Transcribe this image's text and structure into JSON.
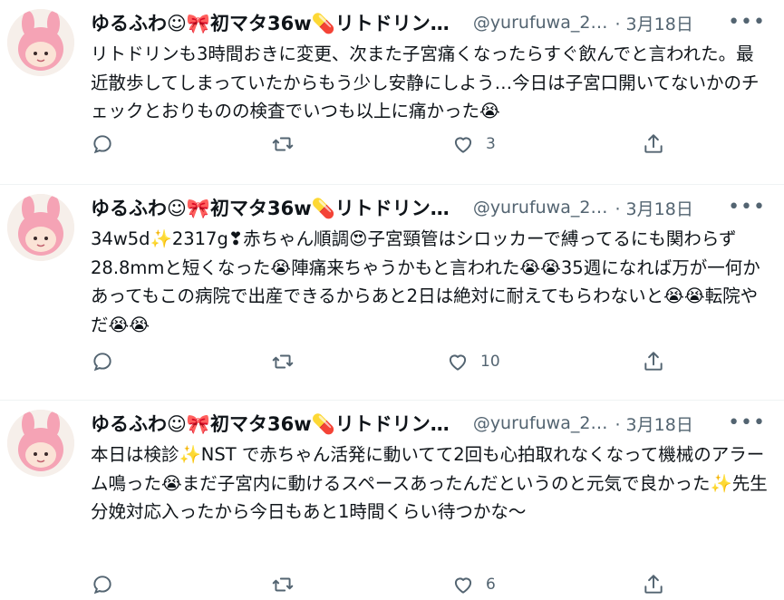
{
  "tweets": [
    {
      "name": "ゆるふわ☺🎀初マタ36w💊リトドリン…",
      "handle": "@yurufuwa_2…",
      "time": "· 3月18日",
      "text": "リトドリンも3時間おきに変更、次また子宮痛くなったらすぐ飲んでと言われた。最近散歩してしまっていたからもう少し安静にしよう…今日は子宮口開いてないかのチェックとおりものの検査でいつも以上に痛かった😭",
      "like_count": "3"
    },
    {
      "name": "ゆるふわ☺🎀初マタ36w💊リトドリン…",
      "handle": "@yurufuwa_2…",
      "time": "· 3月18日",
      "text": "34w5d✨2317g❣赤ちゃん順調😍子宮頸管はシロッカーで縛ってるにも関わらず28.8mmと短くなった😭陣痛来ちゃうかもと言われた😭😭35週になれば万が一何かあってもこの病院で出産できるからあと2日は絶対に耐えてもらわないと😭😭転院やだ😭😭",
      "like_count": "10"
    },
    {
      "name": "ゆるふわ☺🎀初マタ36w💊リトドリン…",
      "handle": "@yurufuwa_2…",
      "time": "· 3月18日",
      "text": "本日は検診✨NST で赤ちゃん活発に動いてて2回も心拍取れなくなって機械のアラーム鳴った😭まだ子宮内に動けるスペースあったんだというのと元気で良かった✨先生分娩対応入ったから今日もあと1時間くらい待つかな〜",
      "like_count": "6"
    }
  ],
  "colors": {
    "text": "#0f1419",
    "secondary": "#536471",
    "divider": "#eff3f4",
    "avatar_pink": "#f5a3b5"
  }
}
